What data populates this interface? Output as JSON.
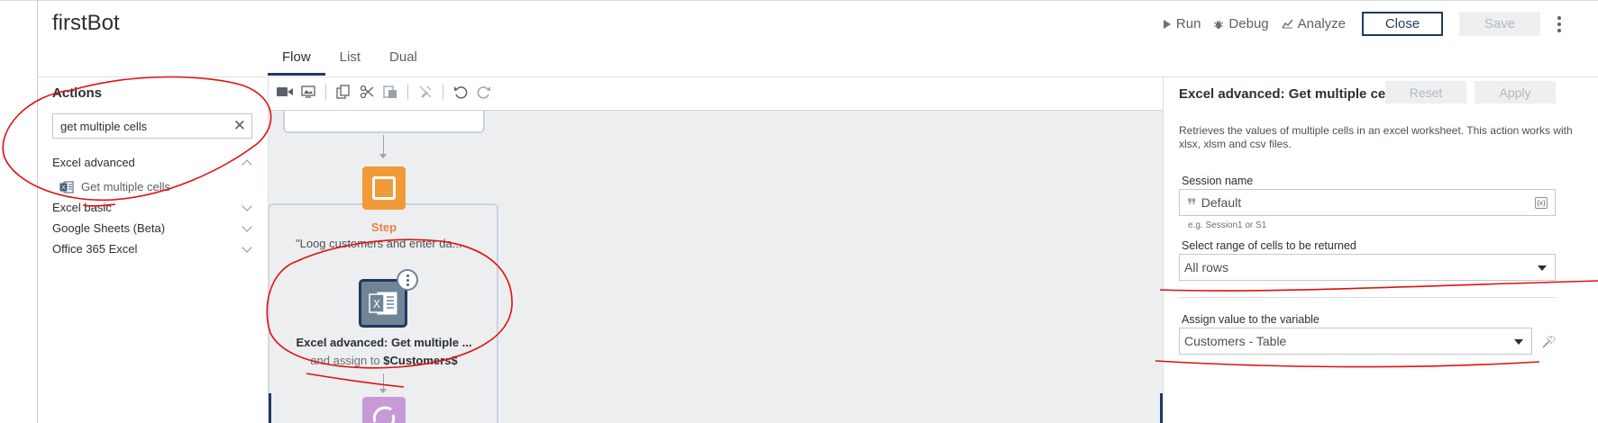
{
  "app": {
    "title": "firstBot"
  },
  "header": {
    "run_label": "Run",
    "debug_label": "Debug",
    "analyze_label": "Analyze",
    "close_label": "Close",
    "save_label": "Save"
  },
  "tabs": [
    {
      "label": "Flow",
      "active": true
    },
    {
      "label": "List",
      "active": false
    },
    {
      "label": "Dual",
      "active": false
    }
  ],
  "actions_panel": {
    "heading": "Actions",
    "search": {
      "value": "get multiple cells"
    },
    "categories": [
      {
        "label": "Excel advanced",
        "expanded": true
      },
      {
        "label": "Excel basic",
        "expanded": false
      },
      {
        "label": "Google Sheets (Beta)",
        "expanded": false
      },
      {
        "label": "Office 365 Excel",
        "expanded": false
      }
    ],
    "result_item": "Get multiple cells"
  },
  "canvas": {
    "step_label": "Step",
    "step_description": "\"Loog customers and enter da...",
    "excel_node_label": "Excel advanced: Get multiple ...",
    "excel_node_sub_prefix": "and assign to ",
    "excel_node_variable": "$Customers$"
  },
  "properties": {
    "title": "Excel advanced: Get multiple cells",
    "reset_label": "Reset",
    "apply_label": "Apply",
    "description": "Retrieves the values of multiple cells in an excel worksheet. This action works with xlsx, xlsm and csv files.",
    "session_label": "Session name",
    "session_value": "Default",
    "session_hint": "e.g. Session1 or S1",
    "range_label": "Select range of cells to be returned",
    "range_value": "All rows",
    "assign_label": "Assign value to the variable",
    "assign_value": "Customers - Table"
  },
  "colors": {
    "accent": "#1f3a5f",
    "step": "#f29a38",
    "annotation": "#e01010"
  }
}
